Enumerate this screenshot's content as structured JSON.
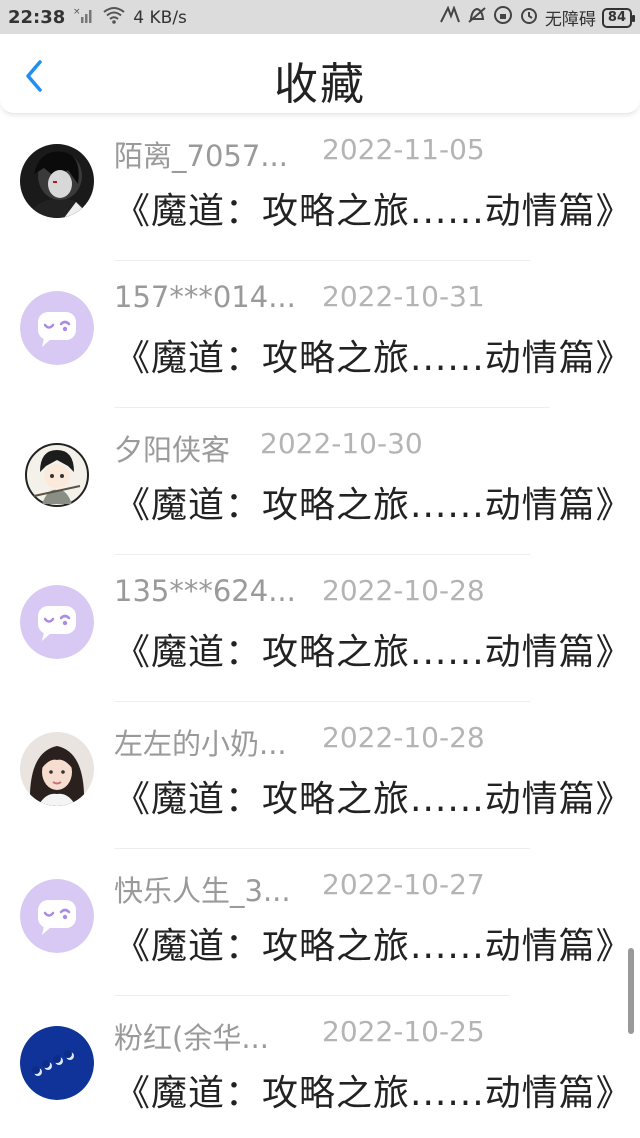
{
  "status_bar": {
    "time": "22:38",
    "speed": "4 KB/s",
    "accessibility": "无障碍",
    "battery": "84"
  },
  "header": {
    "title": "收藏",
    "back_icon": "chevron-left-icon"
  },
  "colors": {
    "accent": "#1f8ff0",
    "default_avatar_bg": "#d8c8f4",
    "default_avatar_fg": "#a98ae6"
  },
  "items": [
    {
      "username": "陌离_7057...",
      "date": "2022-11-05",
      "title": "《魔道：攻略之旅......动情篇》",
      "avatar": "dark-character-avatar"
    },
    {
      "username": "157***014...",
      "date": "2022-10-31",
      "title": "《魔道：攻略之旅......动情篇》",
      "avatar": "default-chat-avatar"
    },
    {
      "username": "夕阳侠客",
      "date": "2022-10-30",
      "title": "《魔道：攻略之旅......动情篇》",
      "avatar": "anime-character-avatar"
    },
    {
      "username": "135***624...",
      "date": "2022-10-28",
      "title": "《魔道：攻略之旅......动情篇》",
      "avatar": "default-chat-avatar"
    },
    {
      "username": "左左的小奶...",
      "date": "2022-10-28",
      "title": "《魔道：攻略之旅......动情篇》",
      "avatar": "girl-photo-avatar"
    },
    {
      "username": "快乐人生_3...",
      "date": "2022-10-27",
      "title": "《魔道：攻略之旅......动情篇》",
      "avatar": "default-chat-avatar"
    },
    {
      "username": "粉红(余华...",
      "date": "2022-10-25",
      "title": "《魔道：攻略之旅......动情篇》",
      "avatar": "blue-moon-avatar"
    }
  ]
}
